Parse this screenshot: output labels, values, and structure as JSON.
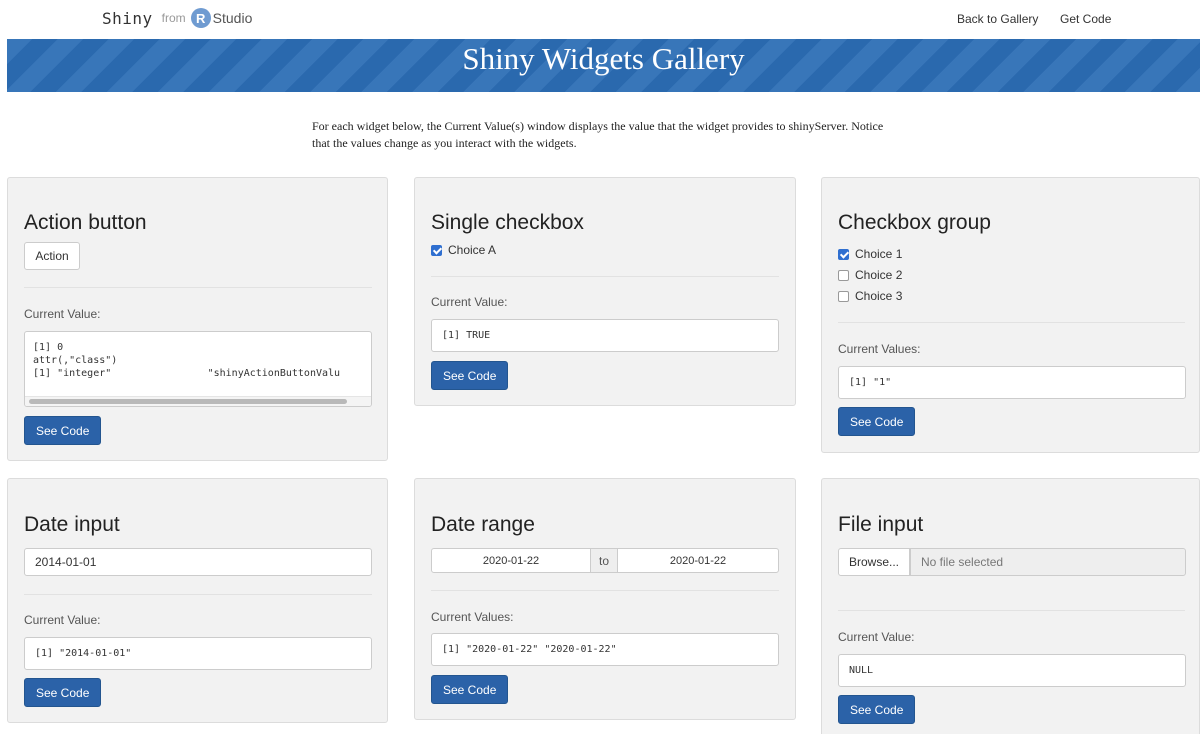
{
  "nav": {
    "brand_shiny": "Shiny",
    "brand_from": "from",
    "brand_r": "R",
    "brand_studio": "Studio",
    "back_to_gallery": "Back to Gallery",
    "get_code": "Get Code"
  },
  "banner": {
    "title": "Shiny Widgets Gallery"
  },
  "intro": {
    "text": "For each widget below, the Current Value(s) window displays the value that the widget provides to shinyServer. Notice that the values change as you interact with the widgets."
  },
  "widgets": {
    "action_button": {
      "title": "Action button",
      "button_label": "Action",
      "current_label": "Current Value:",
      "output": "[1] 0\nattr(,\"class\")\n[1] \"integer\"                \"shinyActionButtonValu",
      "see_code": "See Code"
    },
    "single_checkbox": {
      "title": "Single checkbox",
      "choice_label": "Choice A",
      "checked": true,
      "current_label": "Current Value:",
      "output": "[1] TRUE",
      "see_code": "See Code"
    },
    "checkbox_group": {
      "title": "Checkbox group",
      "choices": [
        {
          "label": "Choice 1",
          "checked": true
        },
        {
          "label": "Choice 2",
          "checked": false
        },
        {
          "label": "Choice 3",
          "checked": false
        }
      ],
      "current_label": "Current Values:",
      "output": "[1] \"1\"",
      "see_code": "See Code"
    },
    "date_input": {
      "title": "Date input",
      "value": "2014-01-01",
      "current_label": "Current Value:",
      "output": "[1] \"2014-01-01\"",
      "see_code": "See Code"
    },
    "date_range": {
      "title": "Date range",
      "start": "2020-01-22",
      "separator": "to",
      "end": "2020-01-22",
      "current_label": "Current Values:",
      "output": "[1] \"2020-01-22\" \"2020-01-22\"",
      "see_code": "See Code"
    },
    "file_input": {
      "title": "File input",
      "browse_label": "Browse...",
      "placeholder": "No file selected",
      "current_label": "Current Value:",
      "output": "NULL",
      "see_code": "See Code"
    }
  },
  "colors": {
    "banner": "#2c6db5",
    "primary_button": "#2b62a8",
    "checkbox_checked": "#2f6fd0",
    "panel_bg": "#f2f2f2"
  }
}
